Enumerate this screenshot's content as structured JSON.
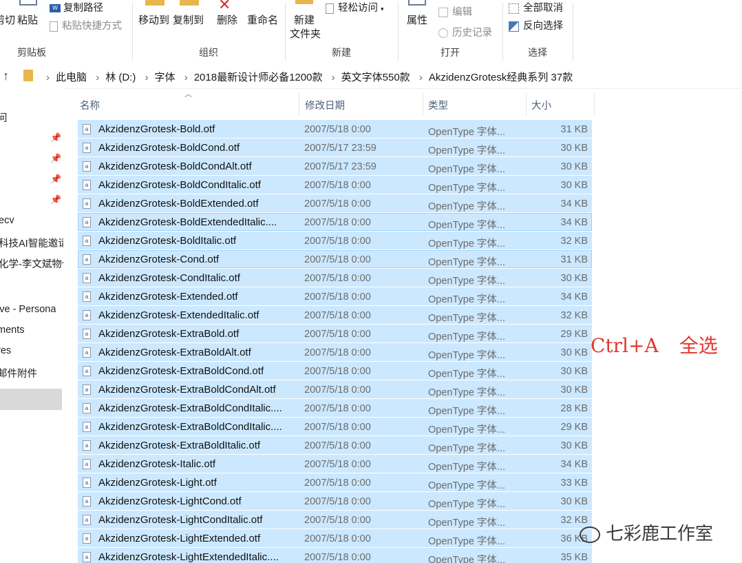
{
  "ribbon": {
    "clipboard": {
      "cut_partial": "剪切",
      "paste": "粘贴",
      "copy_path": "复制路径",
      "paste_shortcut": "粘贴快捷方式",
      "group_label": "剪贴板"
    },
    "organize": {
      "move_to": "移动到",
      "copy_to": "复制到",
      "delete": "删除",
      "rename": "重命名",
      "group_label": "组织"
    },
    "new": {
      "new_folder_line1": "新建",
      "new_folder_line2": "文件夹",
      "easy_access": "轻松访问",
      "group_label": "新建"
    },
    "open": {
      "properties": "属性",
      "edit": "编辑",
      "history": "历史记录",
      "group_label": "打开"
    },
    "select": {
      "select_none": "全部取消",
      "invert_selection": "反向选择",
      "group_label": "选择"
    }
  },
  "address_bar": {
    "crumbs": [
      "此电脑",
      "林 (D:)",
      "字体",
      "2018最新设计师必备1200款",
      "英文字体550款",
      "AkzidenzGrotesk经典系列 37款"
    ]
  },
  "nav": {
    "items": [
      {
        "label": "问"
      },
      {
        "label": "ecv"
      },
      {
        "label": "科技AI智能邀请"
      },
      {
        "label": "化学-李文斌物化"
      },
      {
        "label": "ive - Persona"
      },
      {
        "label": "ments"
      },
      {
        "label": "res"
      },
      {
        "label": "邮件附件"
      }
    ]
  },
  "columns": {
    "name": "名称",
    "date": "修改日期",
    "type": "类型",
    "size": "大小"
  },
  "files": [
    {
      "name": "AkzidenzGrotesk-Bold.otf",
      "date": "2007/5/18 0:00",
      "type": "OpenType 字体...",
      "size": "31 KB"
    },
    {
      "name": "AkzidenzGrotesk-BoldCond.otf",
      "date": "2007/5/17 23:59",
      "type": "OpenType 字体...",
      "size": "30 KB"
    },
    {
      "name": "AkzidenzGrotesk-BoldCondAlt.otf",
      "date": "2007/5/17 23:59",
      "type": "OpenType 字体...",
      "size": "30 KB"
    },
    {
      "name": "AkzidenzGrotesk-BoldCondItalic.otf",
      "date": "2007/5/18 0:00",
      "type": "OpenType 字体...",
      "size": "30 KB"
    },
    {
      "name": "AkzidenzGrotesk-BoldExtended.otf",
      "date": "2007/5/18 0:00",
      "type": "OpenType 字体...",
      "size": "34 KB"
    },
    {
      "name": "AkzidenzGrotesk-BoldExtendedItalic....",
      "date": "2007/5/18 0:00",
      "type": "OpenType 字体...",
      "size": "34 KB"
    },
    {
      "name": "AkzidenzGrotesk-BoldItalic.otf",
      "date": "2007/5/18 0:00",
      "type": "OpenType 字体...",
      "size": "32 KB"
    },
    {
      "name": "AkzidenzGrotesk-Cond.otf",
      "date": "2007/5/18 0:00",
      "type": "OpenType 字体...",
      "size": "31 KB"
    },
    {
      "name": "AkzidenzGrotesk-CondItalic.otf",
      "date": "2007/5/18 0:00",
      "type": "OpenType 字体...",
      "size": "30 KB"
    },
    {
      "name": "AkzidenzGrotesk-Extended.otf",
      "date": "2007/5/18 0:00",
      "type": "OpenType 字体...",
      "size": "34 KB"
    },
    {
      "name": "AkzidenzGrotesk-ExtendedItalic.otf",
      "date": "2007/5/18 0:00",
      "type": "OpenType 字体...",
      "size": "32 KB"
    },
    {
      "name": "AkzidenzGrotesk-ExtraBold.otf",
      "date": "2007/5/18 0:00",
      "type": "OpenType 字体...",
      "size": "29 KB"
    },
    {
      "name": "AkzidenzGrotesk-ExtraBoldAlt.otf",
      "date": "2007/5/18 0:00",
      "type": "OpenType 字体...",
      "size": "30 KB"
    },
    {
      "name": "AkzidenzGrotesk-ExtraBoldCond.otf",
      "date": "2007/5/18 0:00",
      "type": "OpenType 字体...",
      "size": "30 KB"
    },
    {
      "name": "AkzidenzGrotesk-ExtraBoldCondAlt.otf",
      "date": "2007/5/18 0:00",
      "type": "OpenType 字体...",
      "size": "30 KB"
    },
    {
      "name": "AkzidenzGrotesk-ExtraBoldCondItalic....",
      "date": "2007/5/18 0:00",
      "type": "OpenType 字体...",
      "size": "28 KB"
    },
    {
      "name": "AkzidenzGrotesk-ExtraBoldCondItalic....",
      "date": "2007/5/18 0:00",
      "type": "OpenType 字体...",
      "size": "29 KB"
    },
    {
      "name": "AkzidenzGrotesk-ExtraBoldItalic.otf",
      "date": "2007/5/18 0:00",
      "type": "OpenType 字体...",
      "size": "30 KB"
    },
    {
      "name": "AkzidenzGrotesk-Italic.otf",
      "date": "2007/5/18 0:00",
      "type": "OpenType 字体...",
      "size": "34 KB"
    },
    {
      "name": "AkzidenzGrotesk-Light.otf",
      "date": "2007/5/18 0:00",
      "type": "OpenType 字体...",
      "size": "33 KB"
    },
    {
      "name": "AkzidenzGrotesk-LightCond.otf",
      "date": "2007/5/18 0:00",
      "type": "OpenType 字体...",
      "size": "30 KB"
    },
    {
      "name": "AkzidenzGrotesk-LightCondItalic.otf",
      "date": "2007/5/18 0:00",
      "type": "OpenType 字体...",
      "size": "32 KB"
    },
    {
      "name": "AkzidenzGrotesk-LightExtended.otf",
      "date": "2007/5/18 0:00",
      "type": "OpenType 字体...",
      "size": "36 KB"
    },
    {
      "name": "AkzidenzGrotesk-LightExtendedItalic....",
      "date": "2007/5/18 0:00",
      "type": "OpenType 字体...",
      "size": "35 KB"
    }
  ],
  "annotation": {
    "shortcut": "Ctrl+A",
    "meaning": "全选"
  },
  "watermark": {
    "text": "七彩鹿工作室"
  },
  "colors": {
    "selection_bg": "#cce8ff",
    "selection_border": "#99d1ff",
    "annotation_red": "#e0382f",
    "header_text": "#4c607a"
  }
}
